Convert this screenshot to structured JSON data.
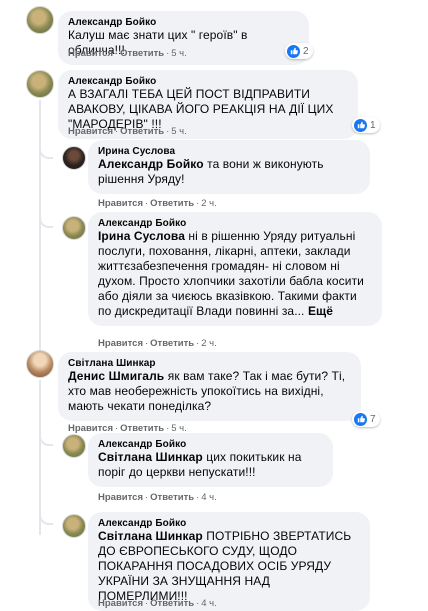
{
  "colors": {
    "like_blue": "#1877f2",
    "bubble_bg": "#f0f2f5",
    "meta_gray": "#65676b"
  },
  "icons": {
    "reaction": "like-icon"
  },
  "comments": [
    {
      "author": "Александр Бойко",
      "text": "Калуш має знати цих \" героїв\" в обличча!!!",
      "actions": {
        "like": "Нравится",
        "reply": "Ответить",
        "time": "5 ч."
      },
      "reactions": "2"
    },
    {
      "author": "Александр Бойко",
      "text": "А ВЗАГАЛІ ТЕБА ЦЕЙ ПОСТ ВІДПРАВИТИ АВАКОВУ, ЦІКАВА ЙОГО РЕАКЦІЯ НА ДІЇ ЦИХ \"МАРОДЕРІВ\" !!!",
      "actions": {
        "like": "Нравится",
        "reply": "Ответить",
        "time": "5 ч."
      },
      "reactions": "1"
    },
    {
      "author": "Ирина Суслова",
      "mention": "Александр Бойко",
      "text": " та вони ж виконують рішення Уряду!",
      "actions": {
        "like": "Нравится",
        "reply": "Ответить",
        "time": "2 ч."
      }
    },
    {
      "author": "Александр Бойко",
      "mention": "Ірина Суслова",
      "text": " ні в рішенню Уряду ритуальні послуги, поховання, лікарні, аптеки, заклади життєзабезпечення громадян- ні словом ні духом. Просто хлопчики захотіли бабла косити або діяли за чиєюсь вказівкою. Такими факти по дискредитації Влади повинні за...",
      "more": "Ещё",
      "actions": {
        "like": "Нравится",
        "reply": "Ответить",
        "time": "2 ч."
      }
    },
    {
      "author": "Світлана Шинкар",
      "mention": "Денис Шмигаль",
      "text": " як вам таке? Так і має бути? Ті, хто мав необережність упокоїтись на вихідні, мають чекати понеділка?",
      "actions": {
        "like": "Нравится",
        "reply": "Ответить",
        "time": "5 ч."
      },
      "reactions": "7"
    },
    {
      "author": "Александр Бойко",
      "mention": "Світлана Шинкар",
      "text": " цих покитькик на поріг до церкви непускати!!!",
      "actions": {
        "like": "Нравится",
        "reply": "Ответить",
        "time": "4 ч."
      }
    },
    {
      "author": "Александр Бойко",
      "mention": "Світлана Шинкар",
      "text": " ПОТРІБНО ЗВЕРТАТИСЬ ДО ЄВРОПЕСЬКОГО СУДУ, ЩОДО ПОКАРАННЯ ПОСАДОВИХ ОСІБ УРЯДУ УКРАЇНИ ЗА ЗНУЩАННЯ НАД ПОМЕРЛИМИ!!!",
      "actions": {
        "like": "Нравится",
        "reply": "Ответить",
        "time": "4 ч."
      }
    }
  ]
}
